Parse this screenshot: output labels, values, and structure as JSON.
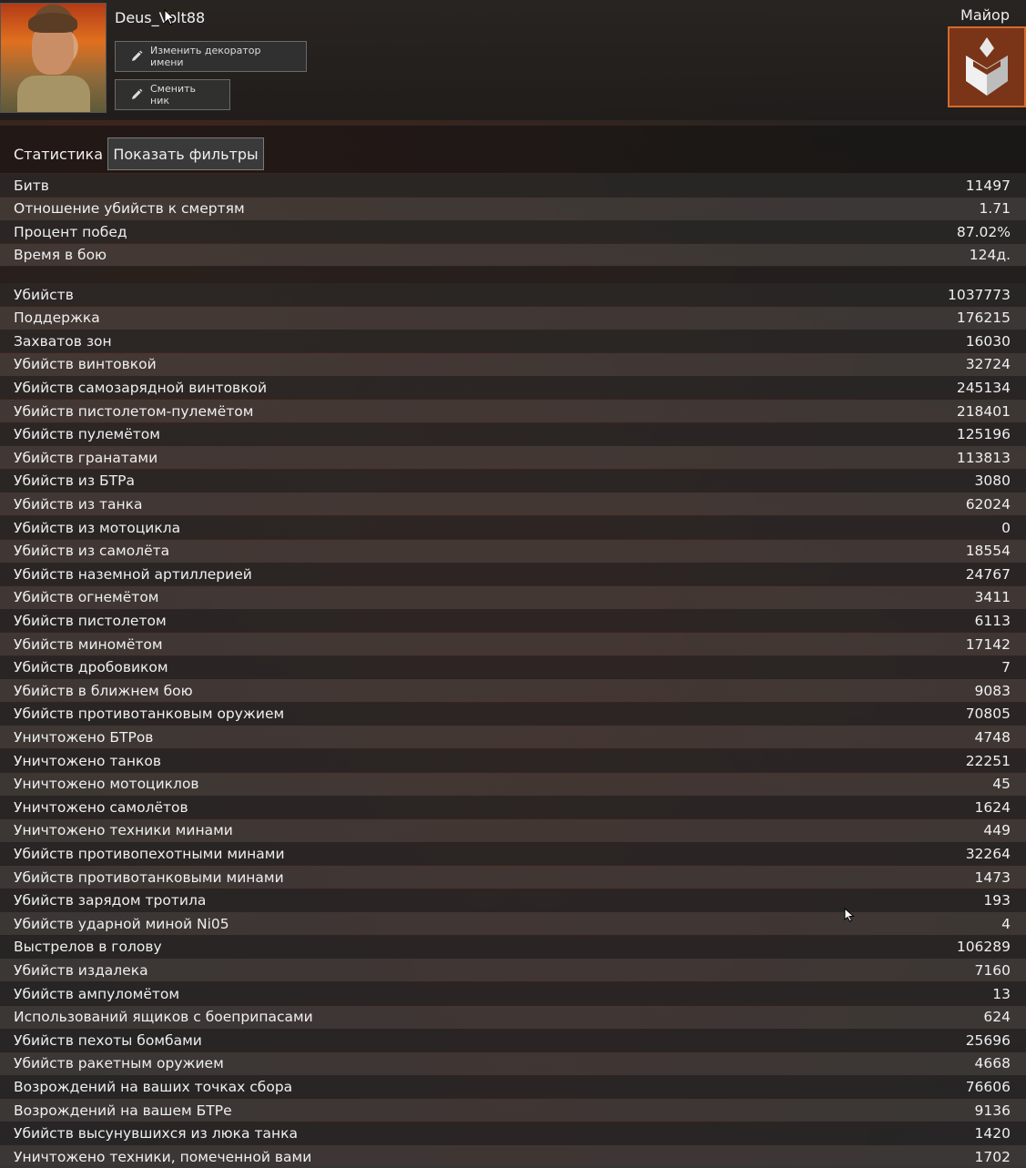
{
  "header": {
    "username": "Deus_Volt88",
    "btn_decorator": "Изменить декоратор имени",
    "btn_nick": "Сменить ник",
    "rank": "Майор"
  },
  "stats": {
    "title": "Статистика",
    "filter_button": "Показать фильтры",
    "summary": [
      {
        "label": "Битв",
        "value": "11497"
      },
      {
        "label": "Отношение убийств к смертям",
        "value": "1.71"
      },
      {
        "label": "Процент побед",
        "value": "87.02%"
      },
      {
        "label": "Время в бою",
        "value": "124д."
      }
    ],
    "details": [
      {
        "label": "Убийств",
        "value": "1037773"
      },
      {
        "label": "Поддержка",
        "value": "176215"
      },
      {
        "label": "Захватов зон",
        "value": "16030"
      },
      {
        "label": "Убийств винтовкой",
        "value": "32724"
      },
      {
        "label": "Убийств самозарядной винтовкой",
        "value": "245134"
      },
      {
        "label": "Убийств пистолетом-пулемётом",
        "value": "218401"
      },
      {
        "label": "Убийств пулемётом",
        "value": "125196"
      },
      {
        "label": "Убийств гранатами",
        "value": "113813"
      },
      {
        "label": "Убийств из БТРа",
        "value": "3080"
      },
      {
        "label": "Убийств из танка",
        "value": "62024"
      },
      {
        "label": "Убийств из мотоцикла",
        "value": "0"
      },
      {
        "label": "Убийств из самолёта",
        "value": "18554"
      },
      {
        "label": "Убийств наземной артиллерией",
        "value": "24767"
      },
      {
        "label": "Убийств огнемётом",
        "value": "3411"
      },
      {
        "label": "Убийств пистолетом",
        "value": "6113"
      },
      {
        "label": "Убийств миномётом",
        "value": "17142"
      },
      {
        "label": "Убийств дробовиком",
        "value": "7"
      },
      {
        "label": "Убийств в ближнем бою",
        "value": "9083"
      },
      {
        "label": "Убийств противотанковым оружием",
        "value": "70805"
      },
      {
        "label": "Уничтожено БТРов",
        "value": "4748"
      },
      {
        "label": "Уничтожено танков",
        "value": "22251"
      },
      {
        "label": "Уничтожено мотоциклов",
        "value": "45"
      },
      {
        "label": "Уничтожено самолётов",
        "value": "1624"
      },
      {
        "label": "Уничтожено техники минами",
        "value": "449"
      },
      {
        "label": "Убийств противопехотными минами",
        "value": "32264"
      },
      {
        "label": "Убийств противотанковыми минами",
        "value": "1473"
      },
      {
        "label": "Убийств зарядом тротила",
        "value": "193"
      },
      {
        "label": "Убийств ударной миной Ni05",
        "value": "4"
      },
      {
        "label": "Выстрелов в голову",
        "value": "106289"
      },
      {
        "label": "Убийств издалека",
        "value": "7160"
      },
      {
        "label": "Убийств ампуломётом",
        "value": "13"
      },
      {
        "label": "Использований ящиков с боеприпасами",
        "value": "624"
      },
      {
        "label": "Убийств пехоты бомбами",
        "value": "25696"
      },
      {
        "label": "Убийств ракетным оружием",
        "value": "4668"
      },
      {
        "label": "Возрождений на ваших точках сбора",
        "value": "76606"
      },
      {
        "label": "Возрождений на вашем БТРе",
        "value": "9136"
      },
      {
        "label": "Убийств высунувшихся из люка танка",
        "value": "1420"
      },
      {
        "label": "Уничтожено техники, помеченной вами",
        "value": "1702"
      }
    ]
  },
  "colors": {
    "accent": "#d46a2e",
    "badge_bg": "#7a3417"
  },
  "icons": [
    "pencil-icon",
    "rank-major-icon",
    "mouse-cursor-icon"
  ]
}
